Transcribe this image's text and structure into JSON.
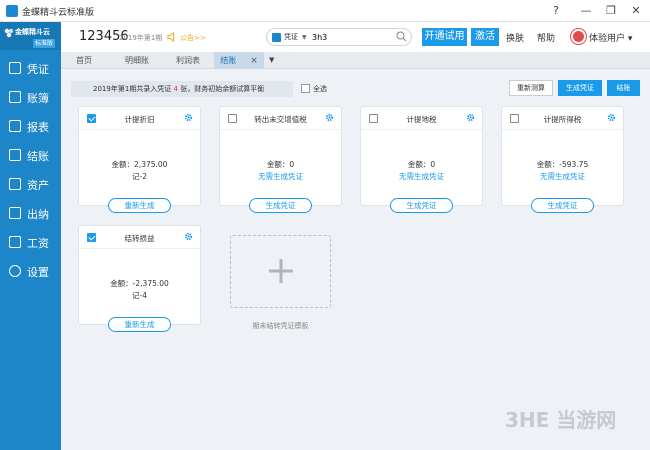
{
  "window": {
    "title": "金蝶精斗云标准版",
    "controls": [
      "?",
      "—",
      "❐",
      "✕"
    ]
  },
  "sidebar": {
    "brand": {
      "name": "金蝶精斗云",
      "edition": "标准版"
    },
    "items": [
      {
        "label": "凭证",
        "icon": "voucher-icon"
      },
      {
        "label": "账簿",
        "icon": "ledger-icon"
      },
      {
        "label": "报表",
        "icon": "report-icon"
      },
      {
        "label": "结账",
        "icon": "close-account-icon"
      },
      {
        "label": "资产",
        "icon": "asset-icon"
      },
      {
        "label": "出纳",
        "icon": "cashier-icon"
      },
      {
        "label": "工资",
        "icon": "salary-icon"
      },
      {
        "label": "设置",
        "icon": "settings-icon"
      }
    ]
  },
  "header": {
    "account": "123456",
    "period": "2019年第1期",
    "notice": "公告>>",
    "search": {
      "type": "凭证",
      "value": "3h3"
    },
    "trial_button": "开通试用",
    "activate_button": "激活",
    "skin": "换肤",
    "help": "帮助",
    "user": "体验用户"
  },
  "tabs": [
    {
      "label": "首页",
      "active": false
    },
    {
      "label": "明细账",
      "active": false
    },
    {
      "label": "利润表",
      "active": false
    },
    {
      "label": "结账",
      "active": true
    }
  ],
  "toolbar": {
    "info_prefix": "2019年第1期共录入凭证 ",
    "info_count": "4",
    "info_suffix": " 张，财务初始余额试算平衡",
    "select_all": "全选",
    "recalc": "重新测算",
    "generate": "生成凭证",
    "close_account": "结账"
  },
  "cards": [
    {
      "title": "计提折旧",
      "checked": true,
      "amount": "金额：2,375.00",
      "sub": "记-2",
      "button": "重新生成"
    },
    {
      "title": "转出未交增值税",
      "checked": false,
      "amount": "金额：0",
      "sub": "无需生成凭证",
      "button": "生成凭证"
    },
    {
      "title": "计提地税",
      "checked": false,
      "amount": "金额：0",
      "sub": "无需生成凭证",
      "button": "生成凭证"
    },
    {
      "title": "计提所得税",
      "checked": false,
      "amount": "金额：-593.75",
      "sub": "无需生成凭证",
      "button": "生成凭证"
    },
    {
      "title": "结转损益",
      "checked": true,
      "amount": "金额：-2,375.00",
      "sub": "记-4",
      "button": "重新生成"
    }
  ],
  "template": {
    "label": "期末结转凭证模板"
  },
  "watermark": "3HE 当游网",
  "colors": {
    "sidebar": "#1d86c8",
    "accent": "#1a9ae8",
    "notice": "#f5a623",
    "count": "#e23b3b"
  }
}
